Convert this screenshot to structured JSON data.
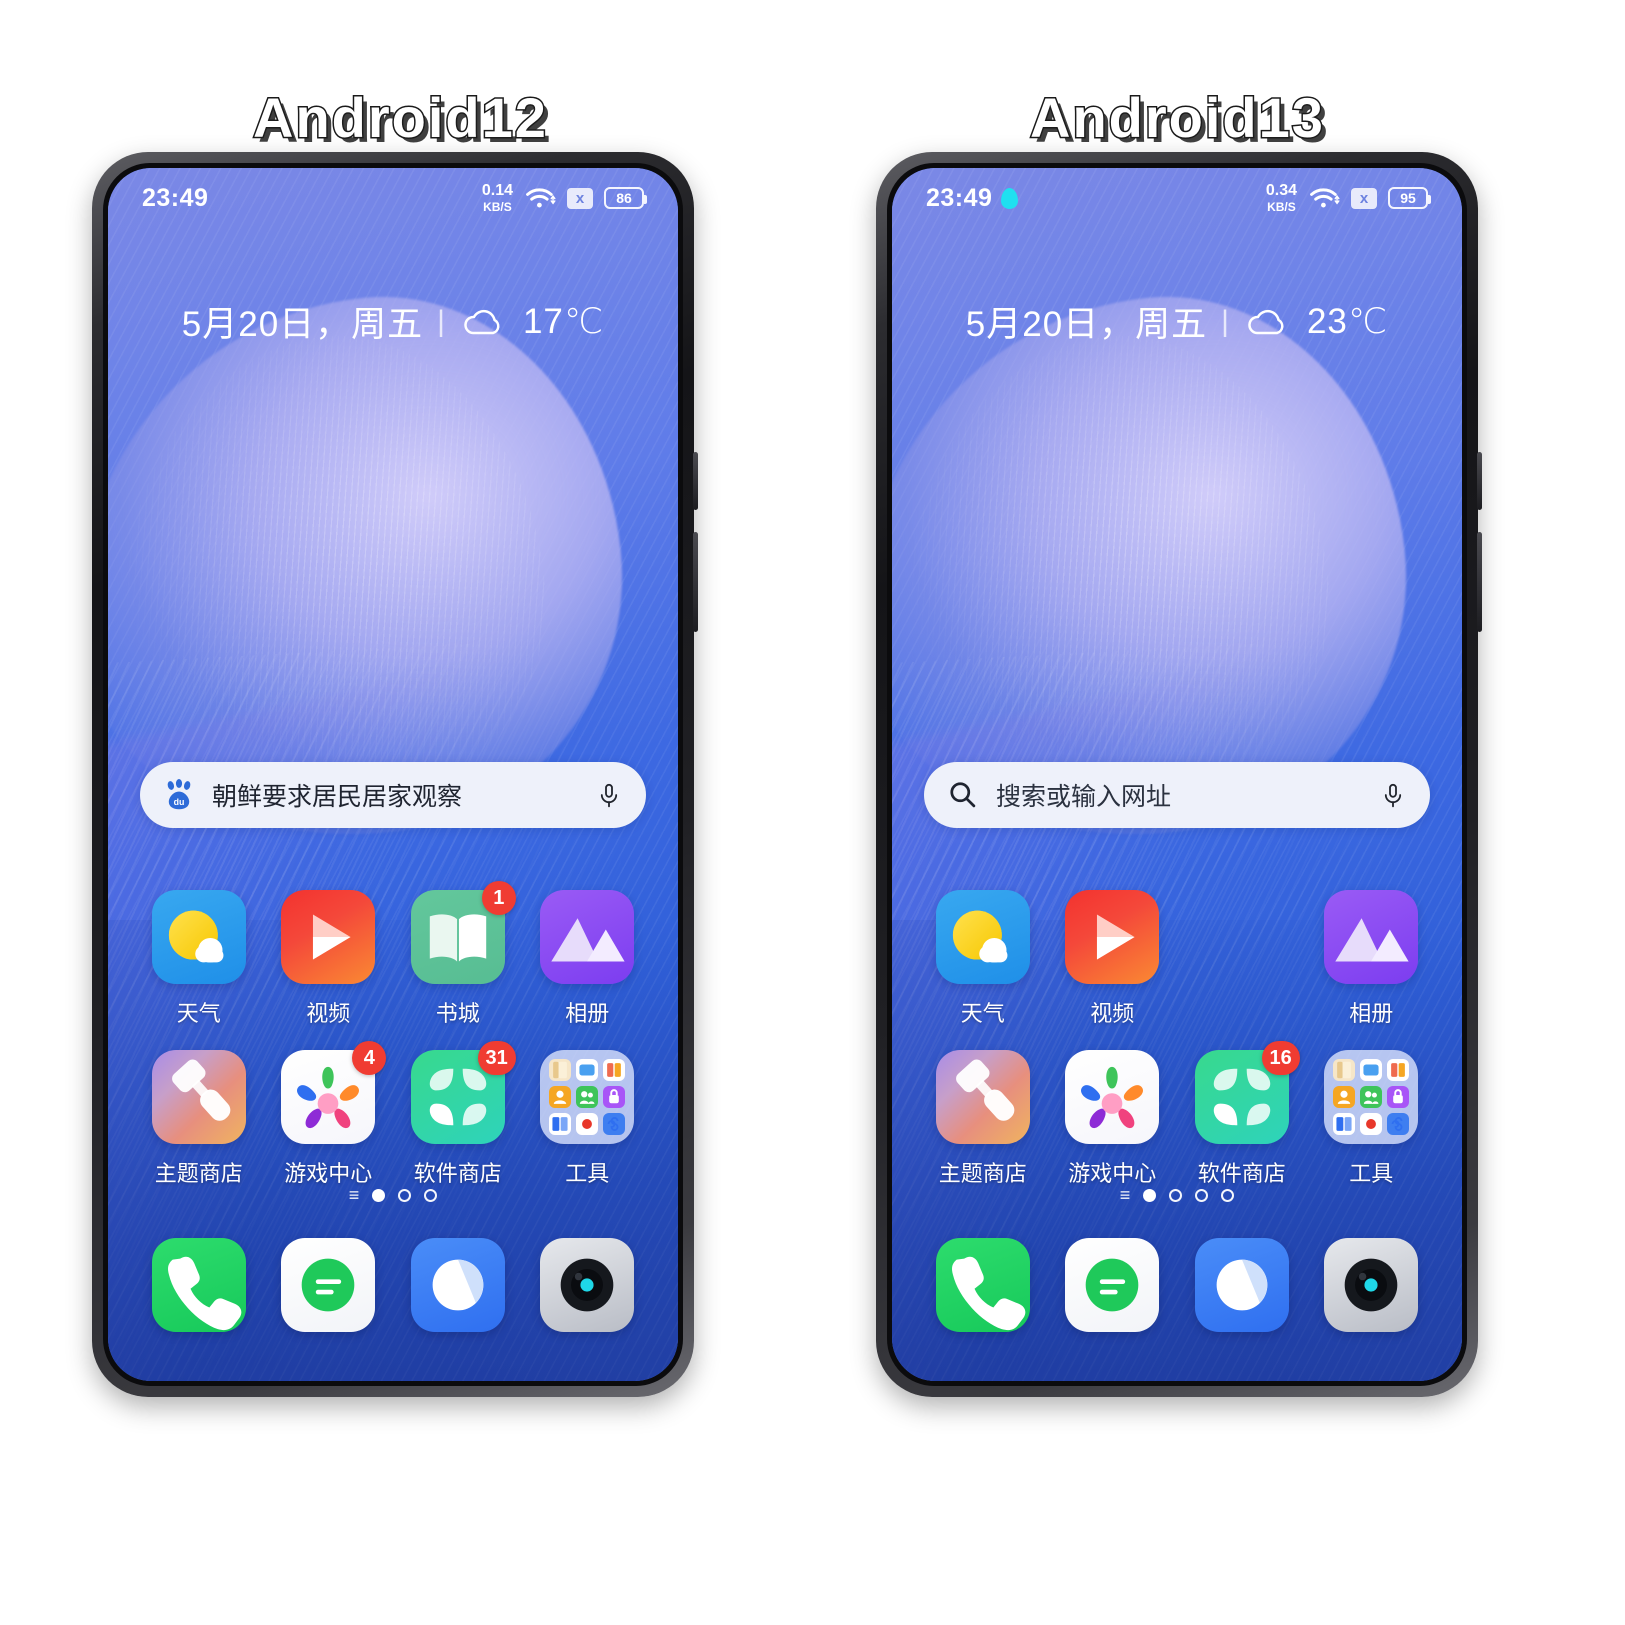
{
  "captions": {
    "left": "Android12",
    "right": "Android13"
  },
  "colors": {
    "badge_red": "#f03c32",
    "privacy_dot_cyan": "#1fe0f0",
    "search_bg": "#eef1fa",
    "wallpaper_blue": "#3d69e2"
  },
  "phones": [
    {
      "id": "android12",
      "statusbar": {
        "clock": "23:49",
        "privacy_dot": false,
        "net_speed_value": "0.14",
        "net_speed_unit": "KB/S",
        "wifi_icon": "wifi-icon",
        "signal_icon": "no-sim-x-icon",
        "signal_label": "x",
        "battery_level": "86"
      },
      "weather": {
        "date": "5月20日，周五",
        "separator": "|",
        "condition_icon": "cloud-icon",
        "temperature": "17℃"
      },
      "search": {
        "engine_icon": "baidu-paw-icon",
        "text": "朝鲜要求居民居家观察",
        "is_placeholder": false,
        "mic_icon": "microphone-icon"
      },
      "apps": [
        [
          {
            "label": "天气",
            "icon": "weather-icon",
            "badge": null
          },
          {
            "label": "视频",
            "icon": "video-icon",
            "badge": null
          },
          {
            "label": "书城",
            "icon": "bookstore-icon",
            "badge": "1"
          },
          {
            "label": "相册",
            "icon": "album-icon",
            "badge": null
          }
        ],
        [
          {
            "label": "主题商店",
            "icon": "theme-store-icon",
            "badge": null
          },
          {
            "label": "游戏中心",
            "icon": "game-center-icon",
            "badge": "4"
          },
          {
            "label": "软件商店",
            "icon": "app-store-icon",
            "badge": "31"
          },
          {
            "label": "工具",
            "icon": "tools-folder-icon",
            "badge": null
          }
        ]
      ],
      "page_indicator": {
        "menu_glyph": "≡",
        "pages": 2,
        "active_index": 0
      },
      "dock": [
        {
          "label": "Phone",
          "icon": "phone-icon"
        },
        {
          "label": "Messages",
          "icon": "messages-icon"
        },
        {
          "label": "Browser",
          "icon": "browser-icon"
        },
        {
          "label": "Camera",
          "icon": "camera-icon"
        }
      ]
    },
    {
      "id": "android13",
      "statusbar": {
        "clock": "23:49",
        "privacy_dot": true,
        "net_speed_value": "0.34",
        "net_speed_unit": "KB/S",
        "wifi_icon": "wifi-icon",
        "signal_icon": "no-sim-x-icon",
        "signal_label": "x",
        "battery_level": "95"
      },
      "weather": {
        "date": "5月20日，周五",
        "separator": "|",
        "condition_icon": "cloud-icon",
        "temperature": "23℃"
      },
      "search": {
        "engine_icon": "magnifier-icon",
        "text": "搜索或输入网址",
        "is_placeholder": true,
        "mic_icon": "microphone-icon"
      },
      "apps": [
        [
          {
            "label": "天气",
            "icon": "weather-icon",
            "badge": null
          },
          {
            "label": "视频",
            "icon": "video-icon",
            "badge": null
          },
          {
            "label": "",
            "icon": "empty-slot",
            "badge": null
          },
          {
            "label": "相册",
            "icon": "album-icon",
            "badge": null
          }
        ],
        [
          {
            "label": "主题商店",
            "icon": "theme-store-icon",
            "badge": null
          },
          {
            "label": "游戏中心",
            "icon": "game-center-icon",
            "badge": null
          },
          {
            "label": "软件商店",
            "icon": "app-store-icon",
            "badge": "16"
          },
          {
            "label": "工具",
            "icon": "tools-folder-icon",
            "badge": null
          }
        ]
      ],
      "page_indicator": {
        "menu_glyph": "≡",
        "pages": 3,
        "active_index": 0
      },
      "dock": [
        {
          "label": "Phone",
          "icon": "phone-icon"
        },
        {
          "label": "Messages",
          "icon": "messages-icon"
        },
        {
          "label": "Browser",
          "icon": "browser-icon"
        },
        {
          "label": "Camera",
          "icon": "camera-icon"
        }
      ]
    }
  ]
}
